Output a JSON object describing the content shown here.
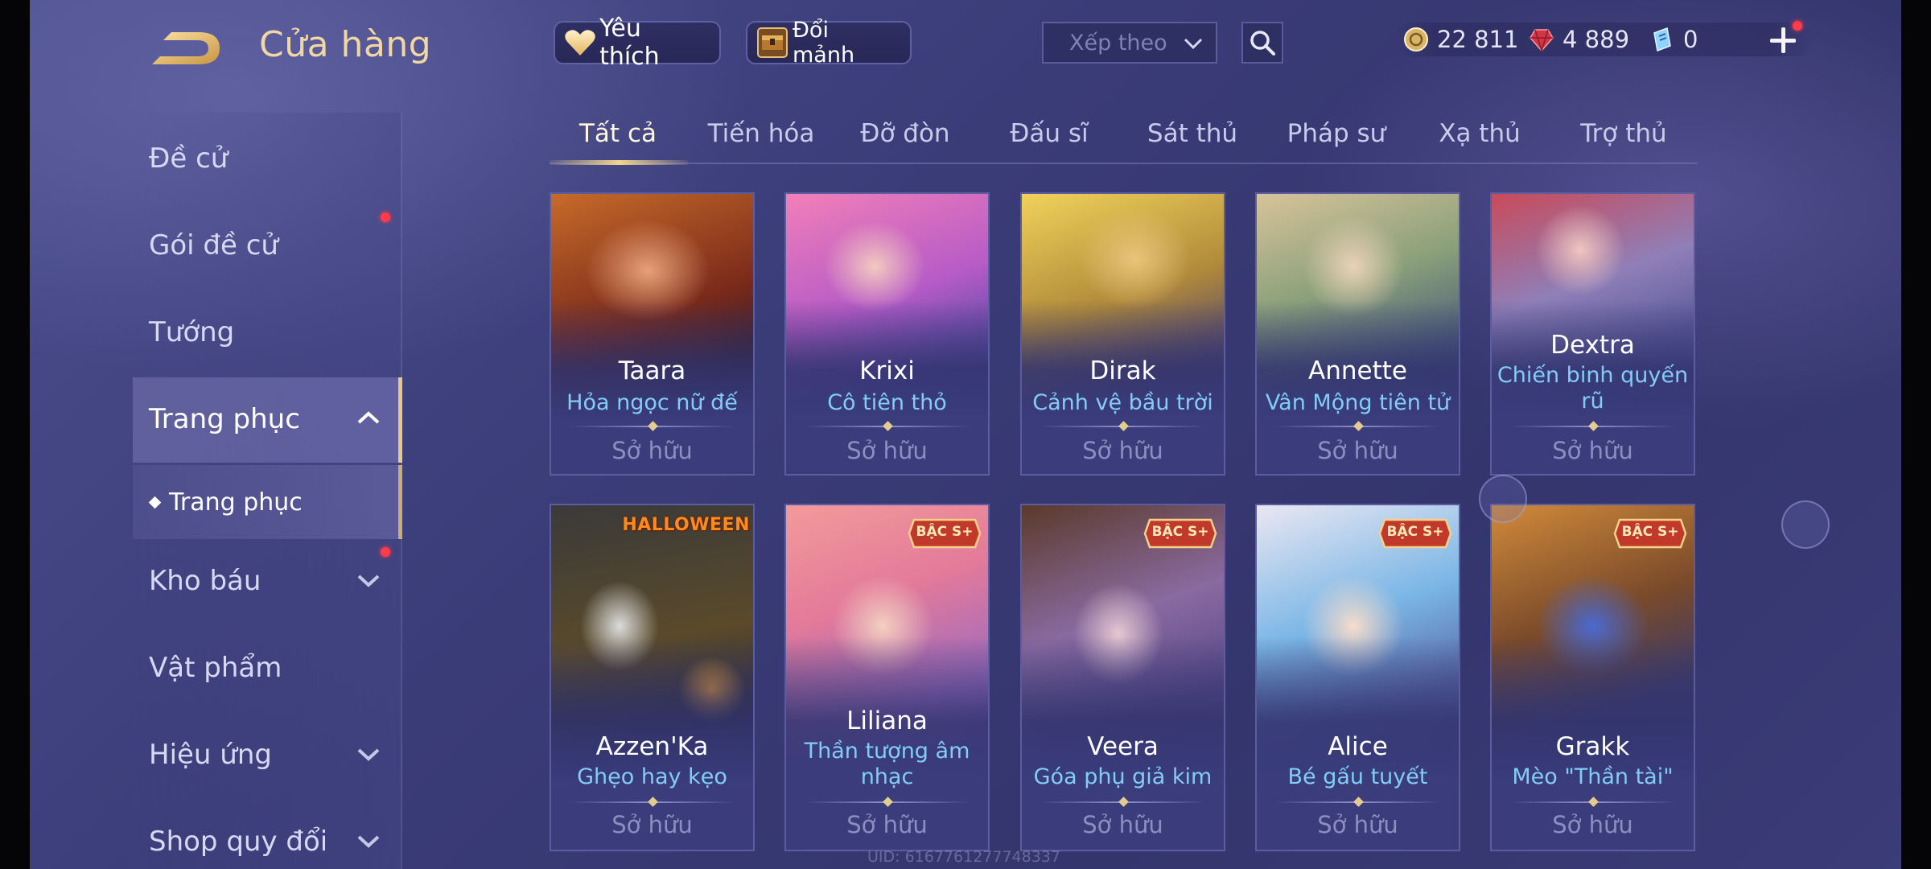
{
  "header": {
    "title": "Cửa hàng",
    "favorite_label": "Yêu thích",
    "fragment_label": "Đổi mảnh",
    "sort_placeholder": "Xếp theo",
    "currencies": {
      "gold": "22 811",
      "ruby": "4 889",
      "voucher": "0"
    }
  },
  "sidebar": {
    "items": [
      {
        "label": "Đề cử"
      },
      {
        "label": "Gói đề cử"
      },
      {
        "label": "Tướng"
      },
      {
        "label": "Trang phục"
      },
      {
        "label": "Kho báu"
      },
      {
        "label": "Vật phẩm"
      },
      {
        "label": "Hiệu ứng"
      },
      {
        "label": "Shop quy đổi"
      }
    ],
    "sub_item": "Trang phục"
  },
  "tabs": [
    "Tất cả",
    "Tiến hóa",
    "Đỡ đòn",
    "Đấu sĩ",
    "Sát thủ",
    "Pháp sư",
    "Xạ thủ",
    "Trợ thủ"
  ],
  "cards": [
    {
      "hero": "Taara",
      "skin": "Hỏa ngọc nữ đế",
      "status": "Sở hữu"
    },
    {
      "hero": "Krixi",
      "skin": "Cô tiên thỏ",
      "status": "Sở hữu"
    },
    {
      "hero": "Dirak",
      "skin": "Cảnh vệ bầu trời",
      "status": "Sở hữu"
    },
    {
      "hero": "Annette",
      "skin": "Vân Mộng tiên tử",
      "status": "Sở hữu"
    },
    {
      "hero": "Dextra",
      "skin": "Chiến binh quyến rũ",
      "status": "Sở hữu"
    },
    {
      "hero": "Azzen'Ka",
      "skin": "Ghẹo hay kẹo",
      "status": "Sở hữu",
      "tag": "HALLOWEEN"
    },
    {
      "hero": "Liliana",
      "skin": "Thần tượng âm nhạc",
      "status": "Sở hữu",
      "tag": "BẬC S+"
    },
    {
      "hero": "Veera",
      "skin": "Góa phụ giả kim",
      "status": "Sở hữu",
      "tag": "BẬC S+"
    },
    {
      "hero": "Alice",
      "skin": "Bé gấu tuyết",
      "status": "Sở hữu",
      "tag": "BẬC S+"
    },
    {
      "hero": "Grakk",
      "skin": "Mèo \"Thần tài\"",
      "status": "Sở hữu",
      "tag": "BẬC S+"
    }
  ],
  "uid": "UID: 6167761277748337",
  "colors": {
    "accent_gold": "#f1d8a2",
    "skin_blue": "#82cdf6",
    "notice_red": "#ff3a4a"
  },
  "icons": [
    "back-arrow-icon",
    "heart-icon",
    "chest-icon",
    "chevron-down-icon",
    "search-icon",
    "gold-coin-icon",
    "ruby-gem-icon",
    "voucher-icon",
    "plus-icon",
    "chevron-up-icon"
  ]
}
